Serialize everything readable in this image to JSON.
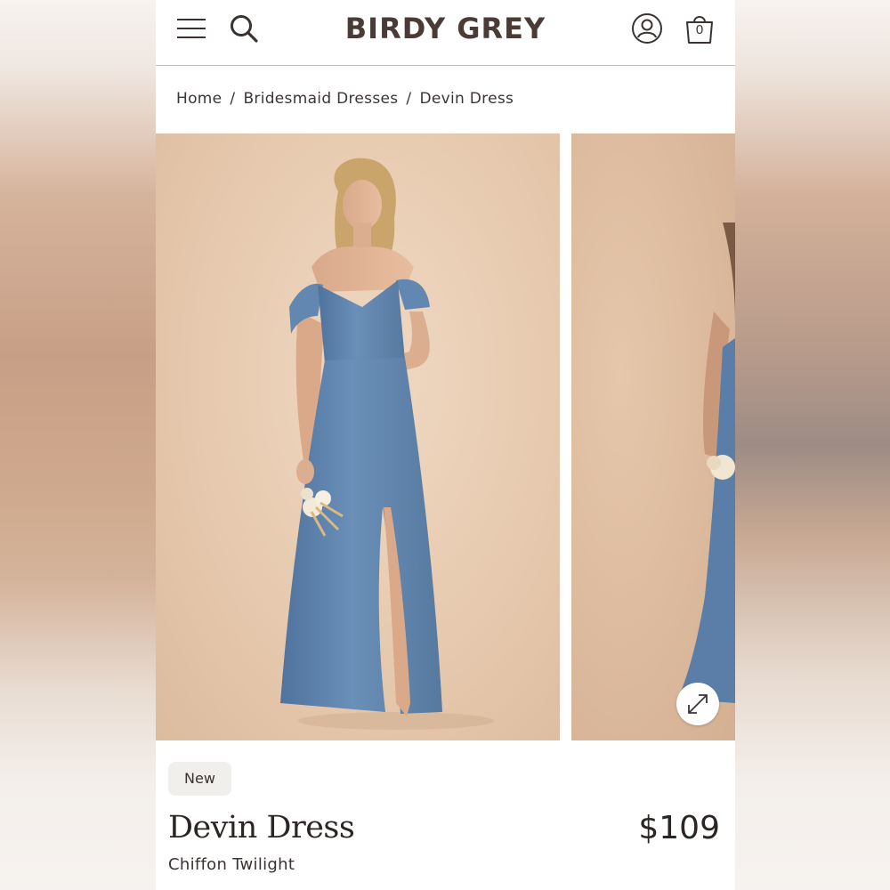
{
  "header": {
    "menu_icon": "hamburger-menu-icon",
    "search_icon": "search-icon",
    "logo": "BIRDY GREY",
    "account_icon": "user-account-icon",
    "bag_icon": "shopping-bag-icon",
    "bag_count": "0"
  },
  "breadcrumb": {
    "items": [
      "Home",
      "Bridesmaid Dresses",
      "Devin Dress"
    ],
    "separator": "/"
  },
  "gallery": {
    "images": [
      {
        "description": "Model in blue off-shoulder chiffon gown holding dried flower bouquet"
      },
      {
        "description": "Side view of model in blue chiffon gown"
      }
    ],
    "expand_icon": "expand-arrows-icon"
  },
  "product": {
    "badge": "New",
    "name": "Devin Dress",
    "price": "$109",
    "color": "Chiffon Twilight"
  },
  "colors": {
    "dress_blue": "#5e82ab",
    "backdrop": "#e8ccb2",
    "text_dark": "#2b2523",
    "logo_brown": "#4a3b36"
  }
}
